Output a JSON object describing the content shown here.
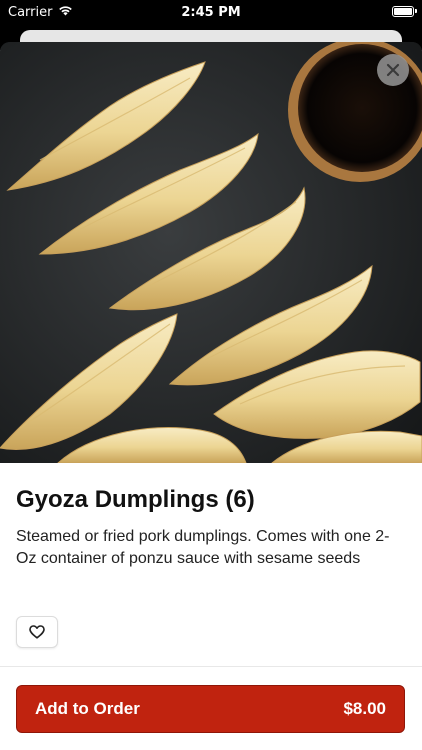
{
  "status_bar": {
    "carrier": "Carrier",
    "time": "2:45 PM"
  },
  "hero": {
    "icon": "food-photo-dumplings",
    "close_icon": "close-icon"
  },
  "item": {
    "title": "Gyoza Dumplings (6)",
    "description": "Steamed or fried pork dumplings. Comes with one 2-Oz container of ponzu sauce with sesame seeds"
  },
  "actions": {
    "favorite_icon": "heart-icon",
    "add_label": "Add to Order",
    "price": "$8.00"
  },
  "colors": {
    "accent": "#c0230f",
    "accent_border": "#8f1608",
    "background": "#ffffff",
    "text": "#111111"
  }
}
